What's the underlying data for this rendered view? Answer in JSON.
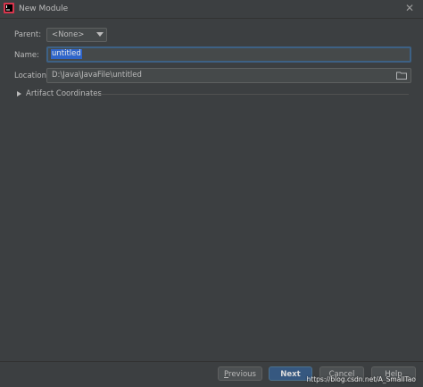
{
  "window": {
    "title": "New Module",
    "app_icon": "intellij-icon",
    "close_icon": "close-icon"
  },
  "form": {
    "parent": {
      "label": "Parent:",
      "value": "<None>"
    },
    "name": {
      "label": "Name:",
      "value": "untitled"
    },
    "location": {
      "label": "Location:",
      "value": "D:\\Java\\JavaFile\\untitled",
      "browse_icon": "folder-icon"
    },
    "artifact": {
      "label": "Artifact Coordinates",
      "expanded": false
    }
  },
  "buttons": {
    "previous": {
      "mnemonic": "P",
      "rest": "revious"
    },
    "next": {
      "label": "Next"
    },
    "cancel": {
      "label": "Cancel"
    },
    "help": {
      "label": "Help"
    }
  },
  "watermark": "https://blog.csdn.net/A_SmallTao",
  "colors": {
    "background": "#3c3f41",
    "accent": "#365880",
    "selection": "#2f65ca"
  }
}
